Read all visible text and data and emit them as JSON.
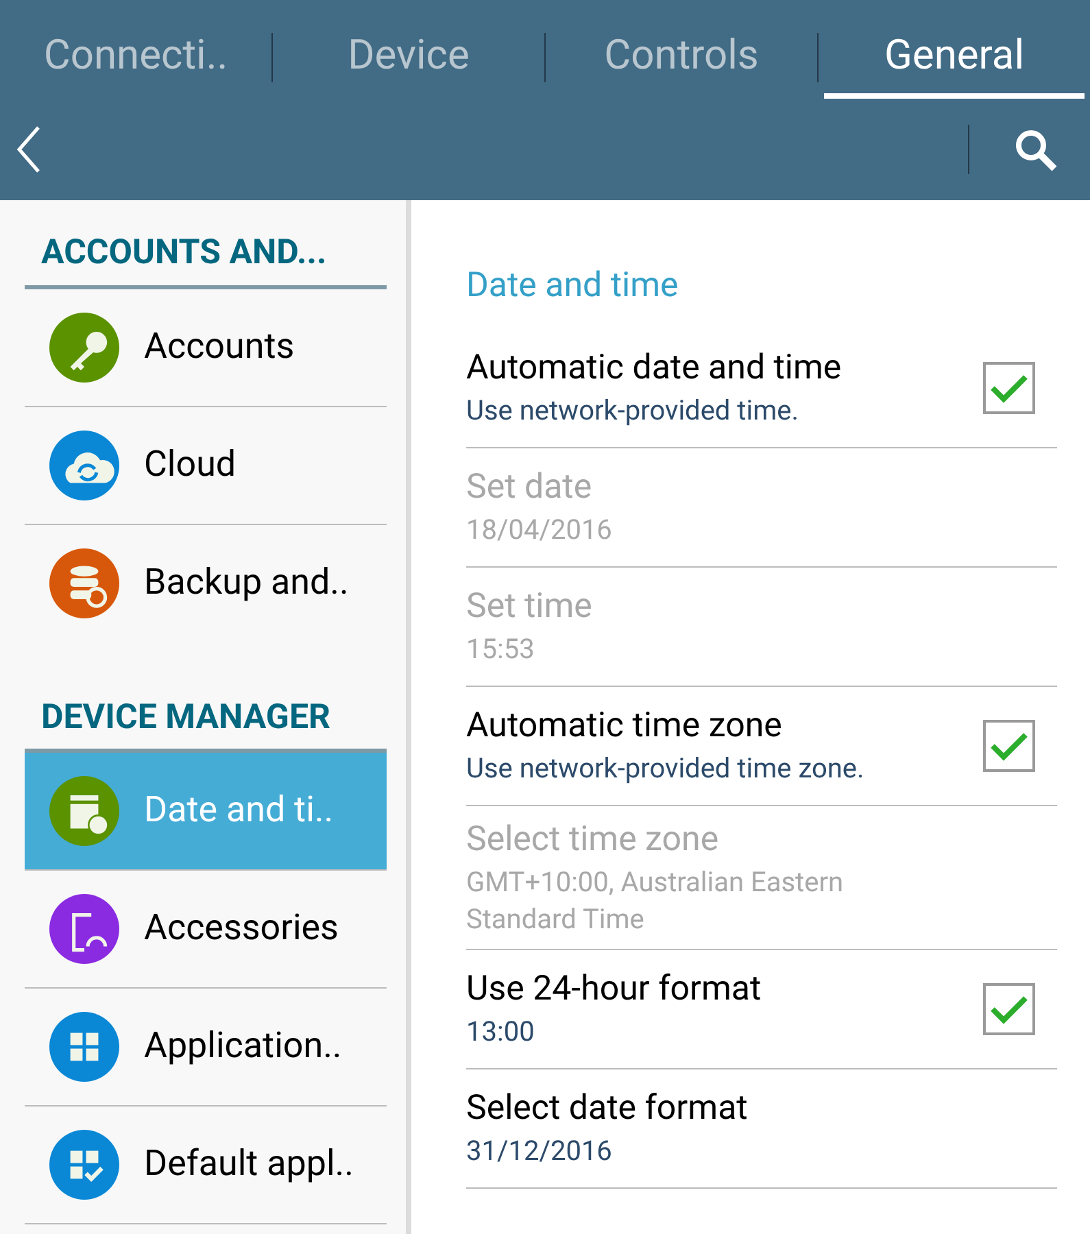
{
  "tabs": [
    {
      "label": "Connecti..",
      "selected": false
    },
    {
      "label": "Device",
      "selected": false
    },
    {
      "label": "Controls",
      "selected": false
    },
    {
      "label": "General",
      "selected": true
    }
  ],
  "sidebar": {
    "sections": [
      {
        "title": "ACCOUNTS AND...",
        "items": [
          {
            "label": "Accounts",
            "kind": "key",
            "color": "#5a9200",
            "selected": false
          },
          {
            "label": "Cloud",
            "kind": "cloud",
            "color": "#0a88d6",
            "selected": false
          },
          {
            "label": "Backup and..",
            "kind": "backup",
            "color": "#d8580b",
            "selected": false
          }
        ]
      },
      {
        "title": "DEVICE MANAGER",
        "items": [
          {
            "label": "Date and ti..",
            "kind": "calendar",
            "color": "#5a9200",
            "selected": true
          },
          {
            "label": "Accessories",
            "kind": "accessory",
            "color": "#8a2be2",
            "selected": false
          },
          {
            "label": "Application..",
            "kind": "grid",
            "color": "#0a88d6",
            "selected": false
          },
          {
            "label": "Default appl..",
            "kind": "gridcheck",
            "color": "#0a88d6",
            "selected": false
          }
        ]
      }
    ]
  },
  "content": {
    "heading": "Date and time",
    "settings": [
      {
        "title": "Automatic date and time",
        "summary": "Use network-provided time.",
        "kind": "checkbox",
        "checked": true,
        "disabled": false
      },
      {
        "title": "Set date",
        "summary": "18/04/2016",
        "kind": "plain",
        "disabled": true
      },
      {
        "title": "Set time",
        "summary": "15:53",
        "kind": "plain",
        "disabled": true
      },
      {
        "title": "Automatic time zone",
        "summary": "Use network-provided time zone.",
        "kind": "checkbox",
        "checked": true,
        "disabled": false
      },
      {
        "title": "Select time zone",
        "summary": "GMT+10:00, Australian Eastern Standard Time",
        "kind": "plain",
        "disabled": true
      },
      {
        "title": "Use 24-hour format",
        "summary": "13:00",
        "kind": "checkbox",
        "checked": true,
        "disabled": false
      },
      {
        "title": "Select date format",
        "summary": "31/12/2016",
        "kind": "plain",
        "disabled": false
      }
    ]
  }
}
